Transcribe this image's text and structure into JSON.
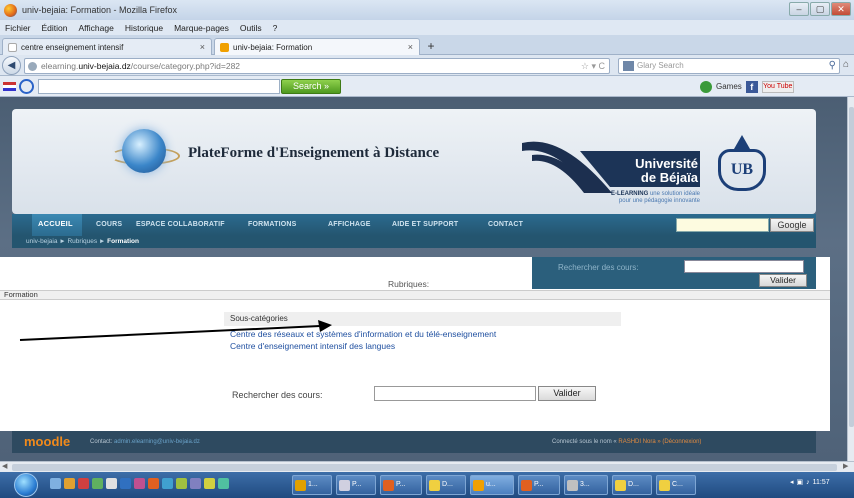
{
  "window": {
    "title": "univ-bejaia: Formation - Mozilla Firefox",
    "buttons": {
      "minimize": "–",
      "maximize": "▢",
      "close": "✕"
    }
  },
  "menubar": [
    "Fichier",
    "Édition",
    "Affichage",
    "Historique",
    "Marque-pages",
    "Outils",
    "?"
  ],
  "tabs": [
    {
      "label": "centre enseignement intensif"
    },
    {
      "label": "univ-bejaia: Formation"
    }
  ],
  "tab_new": "+",
  "tab_close": "×",
  "navbar": {
    "back": "◀",
    "url_prefix": "elearning.",
    "url_domain": "univ-bejaia.dz",
    "url_path": "/course/category.php?id=282",
    "url_icons": "☆ ▾ C",
    "search_placeholder": "Glary Search",
    "search_icon": "⚲",
    "home": "⌂"
  },
  "toolbar2": {
    "search_label": "Search »",
    "games": "Games",
    "fb": "f",
    "yt": "You Tube"
  },
  "banner": {
    "title": "PlateForme d'Enseignement à Distance",
    "univ_line1": "Université",
    "univ_line2": "de Béjaïa",
    "tag_bold": "E-LEARNING",
    "tag_rest": " une solution idéale",
    "tag_line2": "pour une pédagogie innovante",
    "logo": "UB"
  },
  "nav": {
    "items": [
      "ACCUEIL",
      "COURS",
      "ESPACE COLLABORATIF",
      "FORMATIONS",
      "AFFICHAGE",
      "AIDE ET SUPPORT",
      "CONTACT"
    ],
    "google_button": "Google"
  },
  "breadcrumb": {
    "part1": "univ-bejaia",
    "sep": " ► ",
    "part2": "Rubriques",
    "part3": "Formation"
  },
  "top_search": {
    "label": "Rechercher des cours:",
    "button": "Valider"
  },
  "rubriques_label": "Rubriques:",
  "formation_label": "Formation",
  "subcategories": {
    "heading": "Sous-catégories",
    "links": [
      "Centre des réseaux et systèmes d'information et du télé-enseignement",
      "Centre d'enseignement intensif des langues"
    ]
  },
  "course_search": {
    "label": "Rechercher des cours:",
    "button": "Valider"
  },
  "footer": {
    "moodle": "moodle",
    "contact_label": "Contact: ",
    "contact_email": "admin.elearning@univ-bejaia.dz",
    "connected_text": "Connecté sous le nom « ",
    "connected_user": "RASHDI Nora",
    "connected_end": " » (Déconnexion)"
  },
  "taskbar": {
    "buttons": [
      "1...",
      "P...",
      "P...",
      "D...",
      "u...",
      "P...",
      "3...",
      "D...",
      "C..."
    ],
    "clock": "11:57"
  },
  "colors": {
    "nav_bg": "#2b6b8f",
    "footer_bg": "#2e4a60",
    "link": "#2050a0",
    "moodle_orange": "#f08a1b"
  }
}
